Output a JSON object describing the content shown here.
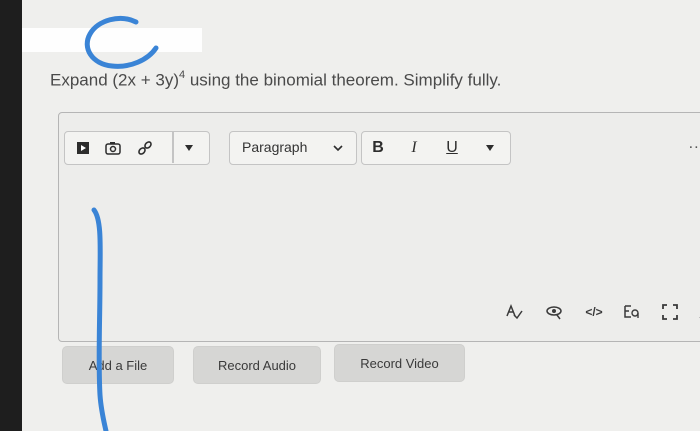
{
  "question": {
    "prefix": "Expand (2x + 3y)",
    "exponent": "4",
    "suffix": " using the binomial theorem. Simplify fully."
  },
  "toolbar": {
    "insert_icons": [
      "video-icon",
      "image-icon",
      "link-icon"
    ],
    "paragraph_label": "Paragraph",
    "bold_label": "B",
    "italic_label": "I",
    "underline_label": "U",
    "more_label": "..."
  },
  "bottom_toolbar": {
    "icons": [
      "spellcheck-icon",
      "accessibility-icon",
      "source-code-icon",
      "equation-icon",
      "fullscreen-icon",
      "resize-icon"
    ],
    "source_code_label": "</>"
  },
  "buttons": {
    "add_file": "Add a File",
    "record_audio": "Record Audio",
    "record_video": "Record Video"
  },
  "colors": {
    "ink": "#3a84d6",
    "page_bg": "#efefed"
  }
}
